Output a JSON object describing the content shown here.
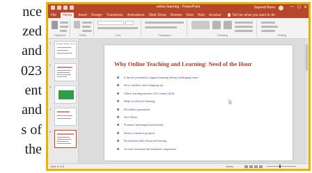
{
  "doc_fragment": {
    "lines": [
      "nce",
      "zed",
      "and",
      "023",
      "ent",
      "and",
      "s of",
      "the"
    ]
  },
  "window": {
    "title": "online learning - PowerPoint",
    "user": "Sayeed Rana",
    "min_glyph": "—",
    "max_glyph": "☐",
    "close_glyph": "✕",
    "accent_color": "#b7472a"
  },
  "ribbon": {
    "tabs": [
      "File",
      "Home",
      "Insert",
      "Design",
      "Transitions",
      "Animations",
      "Slide Show",
      "Review",
      "View",
      "Help",
      "Acrobat"
    ],
    "active_tab": "Home",
    "tell_me": "Tell me what you want to do",
    "groups": [
      "Clipboard",
      "Slides",
      "Font",
      "Paragraph",
      "Drawing",
      "Editing"
    ],
    "font_name": "",
    "font_size": ""
  },
  "thumbnails": [
    {
      "number": "1",
      "caption": "Design Margin Smart"
    },
    {
      "number": "2",
      "caption": ""
    },
    {
      "number": "3",
      "caption": ""
    },
    {
      "number": "4",
      "caption": ""
    },
    {
      "number": "5",
      "caption": ""
    }
  ],
  "slide": {
    "title": "Why Online Teaching and Learning: Need of the Hour",
    "bullets": [
      "It has the potential to support learning during challenging times",
      "Serve students from dropping out",
      "Online learning nurtures 21st century skills",
      "Helps in effective learning",
      "Flexibility guaranteed",
      "Zero Waste",
      "Promotes meaningful interactions",
      "Easier to monitor progress",
      "Personalised and self paced learning",
      "To meet increased and ambulant competition"
    ]
  },
  "statusbar": {
    "slide_info": "Slide 5 of 5",
    "notes": "Notes",
    "zoom": ""
  }
}
